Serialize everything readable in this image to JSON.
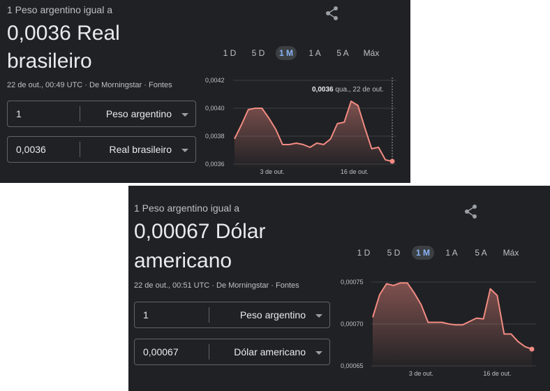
{
  "widgets": [
    {
      "subtitle": "1 Peso argentino igual a",
      "value_line1": "0,0036 Real",
      "value_line2": "brasileiro",
      "meta": "22 de out., 00:49 UTC · De Morningstar · Fontes",
      "from": {
        "amount": "1",
        "currency": "Peso argentino"
      },
      "to": {
        "amount": "0,0036",
        "currency": "Real brasileiro"
      },
      "tabs": [
        "1 D",
        "5 D",
        "1 M",
        "1 A",
        "5 A",
        "Máx"
      ],
      "active_tab": "1 M",
      "tooltip": {
        "value": "0,0036",
        "date": "qua., 22 de out."
      }
    },
    {
      "subtitle": "1 Peso argentino igual a",
      "value_line1": "0,00067 Dólar",
      "value_line2": "americano",
      "meta": "22 de out., 00:51 UTC · De Morningstar · Fontes",
      "from": {
        "amount": "1",
        "currency": "Peso argentino"
      },
      "to": {
        "amount": "0,00067",
        "currency": "Dólar americano"
      },
      "tabs": [
        "1 D",
        "5 D",
        "1 M",
        "1 A",
        "5 A",
        "Máx"
      ],
      "active_tab": "1 M"
    }
  ],
  "colors": {
    "line": "#f28b82",
    "accent": "#8ab4f8",
    "background": "#202124"
  },
  "chart_data": [
    {
      "type": "area",
      "yticks": [
        "0,0042",
        "0,0040",
        "0,0038",
        "0,0036"
      ],
      "xticks": [
        "3 de out.",
        "16 de out."
      ],
      "ylim": [
        0.0036,
        0.0042
      ],
      "xlim": [
        0,
        23
      ],
      "xtick_pos": [
        5.5,
        17.5
      ],
      "x": [
        0,
        1,
        2,
        3,
        4,
        5,
        6,
        7,
        8,
        9,
        10,
        11,
        12,
        13,
        14,
        15,
        16,
        17,
        18,
        19,
        20,
        21,
        22,
        23
      ],
      "values": [
        0.00378,
        0.00388,
        0.00399,
        0.004,
        0.004,
        0.00393,
        0.00385,
        0.00374,
        0.00374,
        0.00375,
        0.00374,
        0.00372,
        0.00375,
        0.00374,
        0.00378,
        0.00389,
        0.0039,
        0.00405,
        0.00402,
        0.00386,
        0.00371,
        0.00372,
        0.00363,
        0.00362
      ]
    },
    {
      "type": "area",
      "yticks": [
        "0,00075",
        "0,00070",
        "0,00065"
      ],
      "xticks": [
        "3 de out.",
        "16 de out."
      ],
      "ylim": [
        0.00065,
        0.00075
      ],
      "xlim": [
        0,
        23
      ],
      "xtick_pos": [
        7,
        18
      ],
      "x": [
        0,
        1,
        2,
        3,
        4,
        5,
        6,
        7,
        8,
        9,
        10,
        11,
        12,
        13,
        14,
        15,
        16,
        17,
        18,
        19,
        20,
        21,
        22,
        23
      ],
      "values": [
        0.000708,
        0.000735,
        0.000748,
        0.000746,
        0.000749,
        0.000749,
        0.000737,
        0.000723,
        0.000702,
        0.000702,
        0.000702,
        0.0007,
        0.000699,
        0.000699,
        0.000703,
        0.000707,
        0.000706,
        0.000742,
        0.000734,
        0.000688,
        0.000688,
        0.000679,
        0.000673,
        0.00067
      ]
    }
  ]
}
